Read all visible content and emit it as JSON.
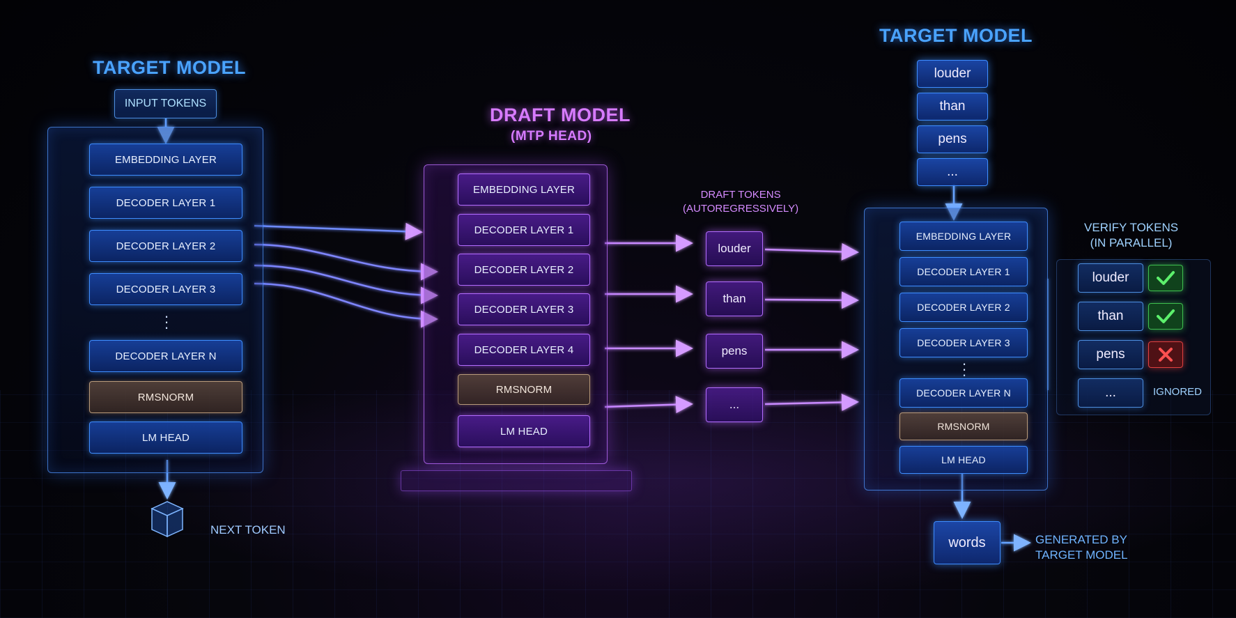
{
  "left": {
    "title": "TARGET MODEL",
    "input_label": "INPUT TOKENS",
    "layers": [
      "EMBEDDING LAYER",
      "DECODER LAYER 1",
      "DECODER LAYER 2",
      "DECODER LAYER 3",
      "DECODER LAYER N",
      "RMSNORM",
      "LM HEAD"
    ],
    "output_label": "NEXT TOKEN"
  },
  "draft": {
    "title": "DRAFT MODEL",
    "subtitle": "(MTP HEAD)",
    "layers": [
      "EMBEDDING LAYER",
      "DECODER LAYER 1",
      "DECODER LAYER 2",
      "DECODER LAYER 3",
      "DECODER LAYER 4",
      "RMSNORM",
      "LM HEAD"
    ],
    "tokens_caption_line1": "DRAFT TOKENS",
    "tokens_caption_line2": "(AUTOREGRESSIVELY)",
    "tokens": [
      "louder",
      "than",
      "pens",
      "..."
    ]
  },
  "right": {
    "title": "TARGET MODEL",
    "input_tokens": [
      "louder",
      "than",
      "pens",
      "..."
    ],
    "layers": [
      "EMBEDDING LAYER",
      "DECODER LAYER 1",
      "DECODER LAYER 2",
      "DECODER LAYER 3",
      "DECODER LAYER N",
      "RMSNORM",
      "LM HEAD"
    ],
    "verify_caption_line1": "VERIFY TOKENS",
    "verify_caption_line2": "(IN PARALLEL)",
    "verify_tokens": [
      "louder",
      "than",
      "pens",
      "..."
    ],
    "verify_status": [
      "accepted",
      "accepted",
      "rejected",
      "ignored"
    ],
    "ignored_label": "IGNORED",
    "output_token": "words",
    "output_caption_line1": "GENERATED BY",
    "output_caption_line2": "TARGET MODEL"
  },
  "colors": {
    "blue_accent": "#4aa3ff",
    "purple_accent": "#d77bff",
    "accept_green": "#3fdc55",
    "reject_red": "#ff4040"
  }
}
